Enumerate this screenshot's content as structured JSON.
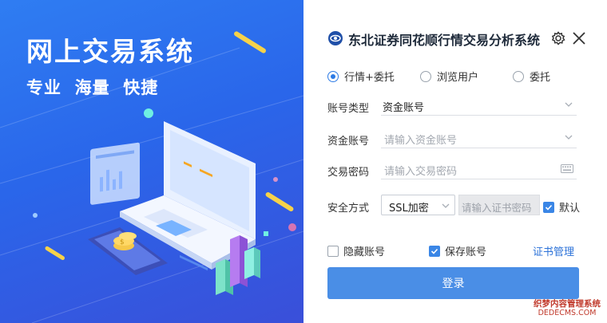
{
  "promo": {
    "title": "网上交易系统",
    "subtitle": "专业  海量  快捷"
  },
  "header": {
    "app_title": "东北证券同花顺行情交易分析系统",
    "icons": [
      "app-logo-icon",
      "gear-icon",
      "close-icon"
    ]
  },
  "mode": {
    "options": [
      "行情+委托",
      "浏览用户",
      "委托"
    ],
    "selected": "行情+委托"
  },
  "form": {
    "account_type_label": "账号类型",
    "account_type_value": "资金账号",
    "fund_account_label": "资金账号",
    "fund_account_placeholder": "请输入资金账号",
    "trade_password_label": "交易密码",
    "trade_password_placeholder": "请输入交易密码",
    "security_label": "安全方式",
    "security_value": "SSL加密",
    "cert_password_placeholder": "请输入证书密码",
    "default_label": "默认",
    "default_checked": true
  },
  "options": {
    "hide_account_label": "隐藏账号",
    "hide_account_checked": false,
    "save_account_label": "保存账号",
    "save_account_checked": true,
    "cert_management_link": "证书管理"
  },
  "login_button_label": "登录",
  "watermark": {
    "line1": "织梦内容管理系统",
    "line2": "DEDECMS.COM"
  },
  "colors": {
    "accent": "#4a8ee6",
    "link": "#2c72d8",
    "promo_bg": "#2f7df2"
  }
}
